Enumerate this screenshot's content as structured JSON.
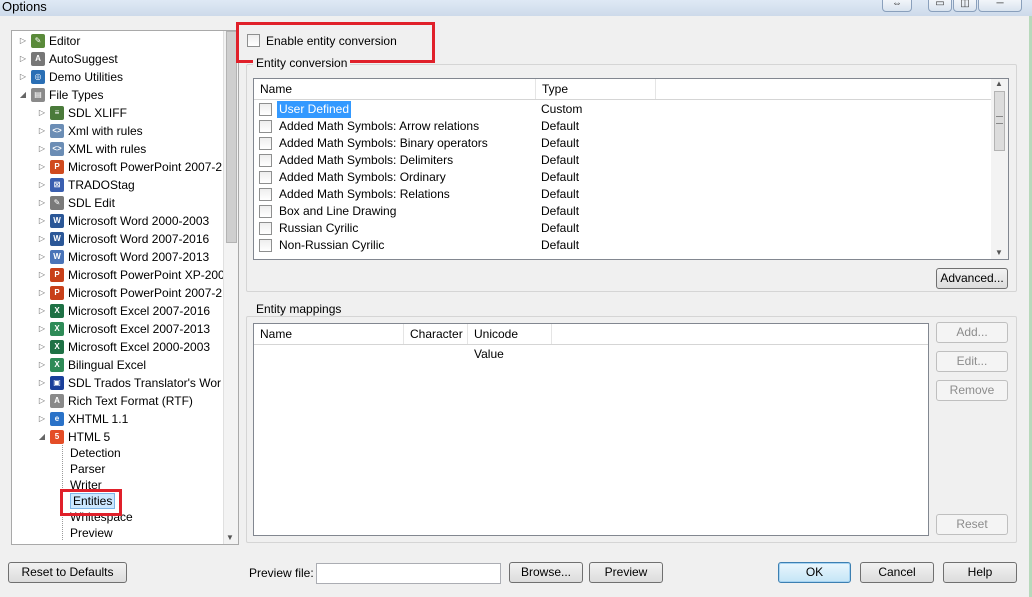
{
  "window": {
    "title": "Options"
  },
  "tree": {
    "top_items": [
      {
        "label": "Editor",
        "icon": "pencil-icon",
        "color": "#5a8a3a",
        "glyph": "✎"
      },
      {
        "label": "AutoSuggest",
        "icon": "autosuggest-icon",
        "color": "#777777",
        "glyph": "A"
      },
      {
        "label": "Demo Utilities",
        "icon": "demo-utilities-icon",
        "color": "#2a6fb5",
        "glyph": "◎"
      },
      {
        "label": "File Types",
        "icon": "file-types-icon",
        "color": "#8a8a8a",
        "glyph": "▤"
      }
    ],
    "file_types": [
      {
        "label": "SDL XLIFF",
        "icon": "sdl-xliff-icon",
        "color": "#4a7a3a",
        "glyph": "≡"
      },
      {
        "label": "Xml with rules",
        "icon": "xml-icon",
        "color": "#6b8db5",
        "glyph": "<>"
      },
      {
        "label": "XML with rules",
        "icon": "xml-icon",
        "color": "#6b8db5",
        "glyph": "<>"
      },
      {
        "label": "Microsoft PowerPoint 2007-2",
        "icon": "powerpoint-icon",
        "color": "#d04a1e",
        "glyph": "P"
      },
      {
        "label": "TRADOStag",
        "icon": "tradostag-icon",
        "color": "#3a5fb0",
        "glyph": "⊠"
      },
      {
        "label": "SDL Edit",
        "icon": "sdl-edit-icon",
        "color": "#7a7a7a",
        "glyph": "✎"
      },
      {
        "label": "Microsoft Word 2000-2003",
        "icon": "word-icon",
        "color": "#2b5797",
        "glyph": "W"
      },
      {
        "label": "Microsoft Word 2007-2016",
        "icon": "word-icon",
        "color": "#2b5797",
        "glyph": "W"
      },
      {
        "label": "Microsoft Word 2007-2013",
        "icon": "word-icon",
        "color": "#4a74b8",
        "glyph": "W"
      },
      {
        "label": "Microsoft PowerPoint XP-200",
        "icon": "powerpoint-icon",
        "color": "#c8401a",
        "glyph": "P"
      },
      {
        "label": "Microsoft PowerPoint 2007-2",
        "icon": "powerpoint-icon",
        "color": "#c8401a",
        "glyph": "P"
      },
      {
        "label": "Microsoft Excel 2007-2016",
        "icon": "excel-icon",
        "color": "#1e7145",
        "glyph": "X"
      },
      {
        "label": "Microsoft Excel 2007-2013",
        "icon": "excel-icon",
        "color": "#2e8b57",
        "glyph": "X"
      },
      {
        "label": "Microsoft Excel 2000-2003",
        "icon": "excel-icon",
        "color": "#1e7145",
        "glyph": "X"
      },
      {
        "label": "Bilingual Excel",
        "icon": "bilingual-excel-icon",
        "color": "#2e8b57",
        "glyph": "X"
      },
      {
        "label": "SDL Trados Translator's Wor",
        "icon": "translators-workbench-icon",
        "color": "#1a3f9a",
        "glyph": "▣"
      },
      {
        "label": "Rich Text Format (RTF)",
        "icon": "rtf-icon",
        "color": "#8a8a8a",
        "glyph": "A"
      },
      {
        "label": "XHTML 1.1",
        "icon": "xhtml-icon",
        "color": "#2a72c8",
        "glyph": "e"
      },
      {
        "label": "HTML 5",
        "icon": "html5-icon",
        "color": "#e44d26",
        "glyph": "5"
      }
    ],
    "html5_children": [
      {
        "label": "Detection"
      },
      {
        "label": "Parser"
      },
      {
        "label": "Writer"
      },
      {
        "label": "Entities",
        "selected": true
      },
      {
        "label": "Whitespace"
      },
      {
        "label": "Preview"
      }
    ]
  },
  "entity_conversion": {
    "enable_label": "Enable entity conversion",
    "group_label": "Entity conversion",
    "columns": [
      "Name",
      "Type"
    ],
    "rows": [
      {
        "name": "User Defined",
        "type": "Custom"
      },
      {
        "name": "Added Math Symbols: Arrow relations",
        "type": "Default"
      },
      {
        "name": "Added Math Symbols: Binary operators",
        "type": "Default"
      },
      {
        "name": "Added Math Symbols: Delimiters",
        "type": "Default"
      },
      {
        "name": "Added Math Symbols: Ordinary",
        "type": "Default"
      },
      {
        "name": "Added Math Symbols: Relations",
        "type": "Default"
      },
      {
        "name": "Box and Line Drawing",
        "type": "Default"
      },
      {
        "name": "Russian Cyrilic",
        "type": "Default"
      },
      {
        "name": "Non-Russian Cyrilic",
        "type": "Default"
      }
    ],
    "advanced_label": "Advanced..."
  },
  "entity_mappings": {
    "group_label": "Entity mappings",
    "columns": [
      "Name",
      "Character",
      "Unicode Value"
    ],
    "add_label": "Add...",
    "edit_label": "Edit...",
    "remove_label": "Remove",
    "reset_label": "Reset"
  },
  "footer": {
    "reset_defaults_label": "Reset to Defaults",
    "preview_file_label": "Preview file:",
    "preview_file_value": "",
    "browse_label": "Browse...",
    "preview_label": "Preview",
    "ok_label": "OK",
    "cancel_label": "Cancel",
    "help_label": "Help"
  },
  "colors": {
    "highlight_box": "#e0202a",
    "selection": "#3399ff"
  }
}
